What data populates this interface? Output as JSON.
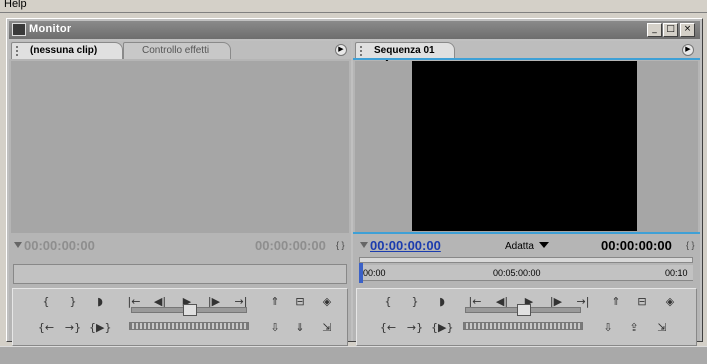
{
  "menubar": {
    "help": "Help"
  },
  "window": {
    "title": "Monitor",
    "minimize": "_",
    "maximize": "□",
    "close": "×"
  },
  "source": {
    "tab_active": "(nessuna clip)",
    "tab_inactive": "Controllo effetti",
    "timecode_left": "00:00:00:00",
    "timecode_right": "00:00:00:00",
    "bracket": "{ }"
  },
  "program": {
    "tab_active": "Sequenza 01",
    "tab_close": "×",
    "timecode_left": "00:00:00:00",
    "fit_label": "Adatta",
    "timecode_right": "00:00:00:00",
    "bracket": "{ }",
    "ruler_start": "00:00",
    "ruler_mid": "00:05:00:00",
    "ruler_end": "00:10"
  },
  "controls": {
    "mark_in": "{",
    "mark_out": "}",
    "set_marker": "◗",
    "goto_in": "|←",
    "step_back": "◀|",
    "play": "▶",
    "step_fwd": "|▶",
    "goto_out": "→|",
    "lift": "⇑",
    "trim": "⊟",
    "output": "◈",
    "goto_prev": "{←",
    "goto_next": "→}",
    "play_in_out": "{▶}",
    "insert": "⇩",
    "overlay": "⇓",
    "extract": "⇪",
    "export": "⇲"
  },
  "colors": {
    "accent": "#3ea0d6",
    "timecode_blue": "#1b3cae"
  }
}
